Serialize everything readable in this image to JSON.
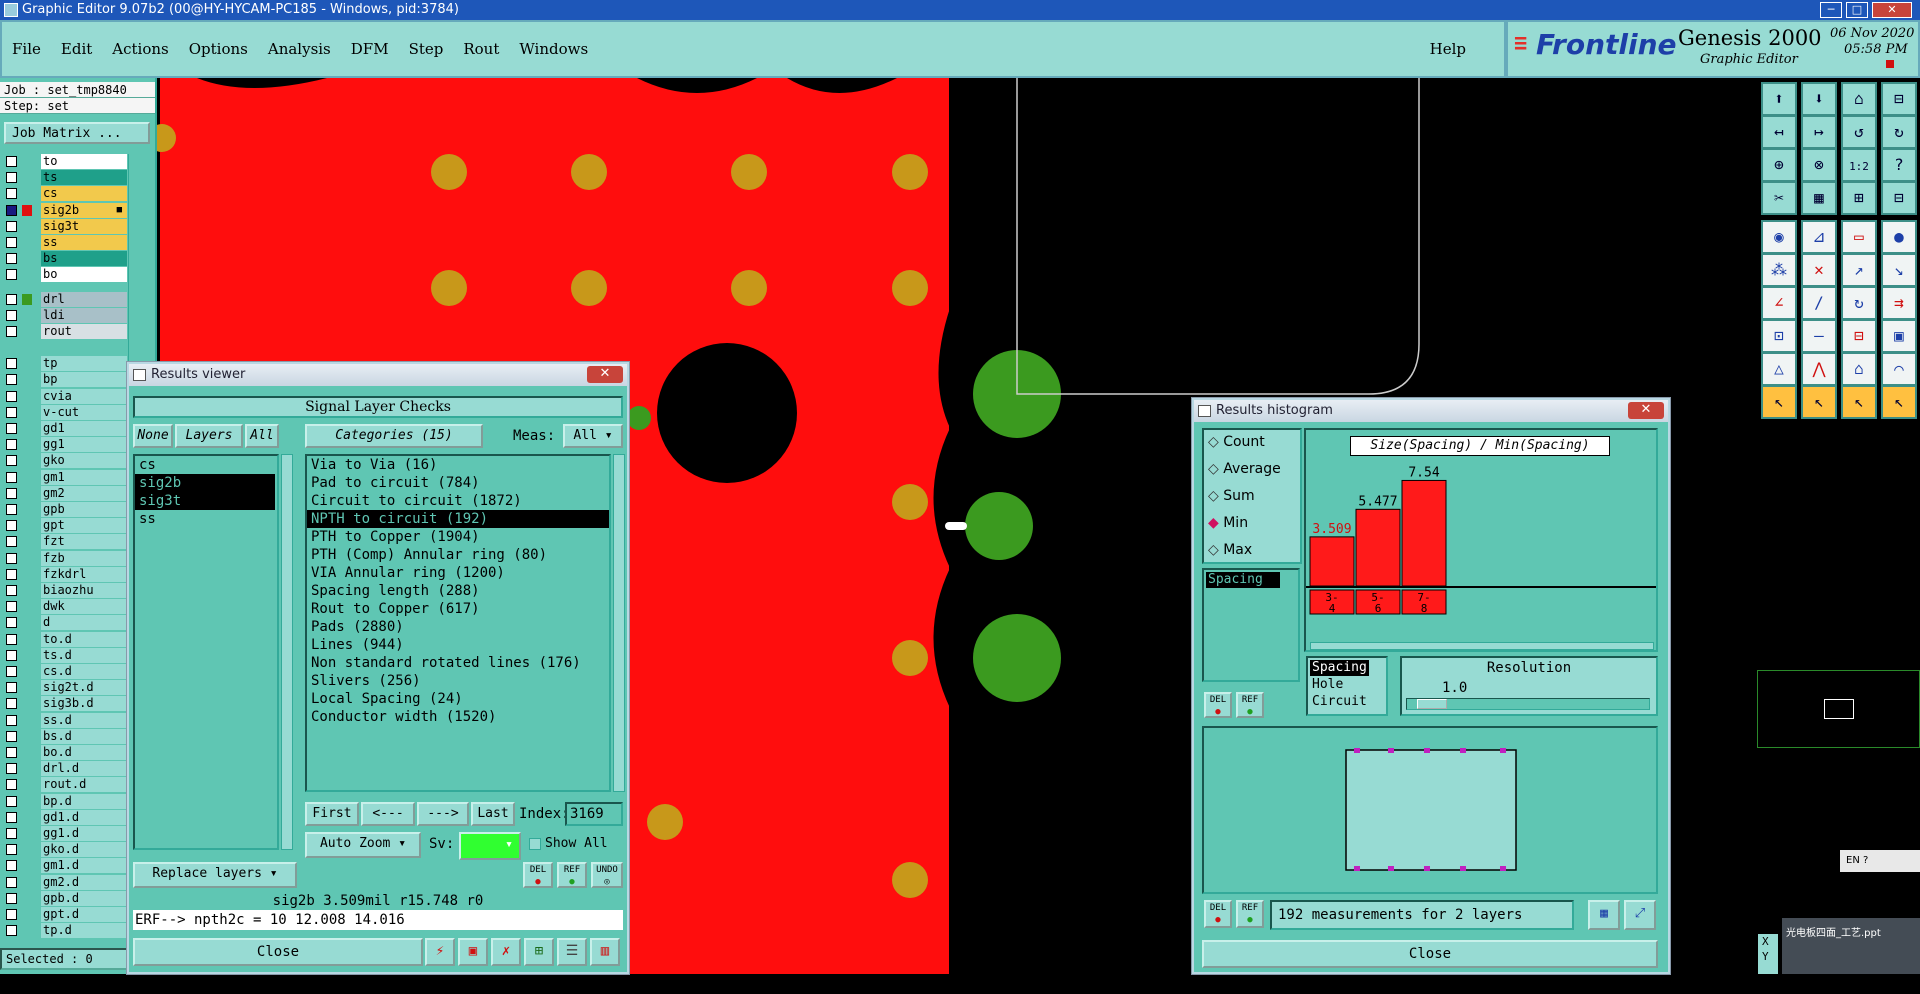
{
  "window": {
    "title": "Graphic Editor 9.07b2 (00@HY-HYCAM-PC185 - Windows, pid:3784)"
  },
  "menu": {
    "items": [
      "File",
      "Edit",
      "Actions",
      "Options",
      "Analysis",
      "DFM",
      "Step",
      "Rout",
      "Windows"
    ],
    "help": "Help"
  },
  "brand": {
    "vendor": "Frontline",
    "product": "Genesis 2000",
    "subtitle": "Graphic Editor",
    "date": "06 Nov 2020",
    "time": "05:58 PM"
  },
  "job": {
    "job_label": "Job : set_tmp8840",
    "step_label": "Step: set",
    "matrix_button": "Job Matrix ..."
  },
  "layers": [
    {
      "name": "to",
      "bg": "#ffffff",
      "sw": ""
    },
    {
      "name": "ts",
      "bg": "#1fa08a",
      "sw": ""
    },
    {
      "name": "cs",
      "bg": "#f2c94c",
      "sw": ""
    },
    {
      "name": "sig2b",
      "bg": "#f2c94c",
      "sw": "#e01010",
      "mark": "■",
      "sel": true
    },
    {
      "name": "sig3t",
      "bg": "#f2c94c",
      "sw": ""
    },
    {
      "name": "ss",
      "bg": "#f2c94c",
      "sw": ""
    },
    {
      "name": "bs",
      "bg": "#1fa08a",
      "sw": ""
    },
    {
      "name": "bo",
      "bg": "#ffffff",
      "sw": ""
    },
    {
      "name": "drl",
      "bg": "#a8c0c8",
      "sw": "#3b9a1f"
    },
    {
      "name": "ldi",
      "bg": "#a8c0c8",
      "sw": ""
    },
    {
      "name": "rout",
      "bg": "#d8e0e4",
      "sw": ""
    },
    {
      "name": "tp",
      "bg": "#97dbd3",
      "sw": ""
    },
    {
      "name": "bp",
      "bg": "#97dbd3",
      "sw": ""
    },
    {
      "name": "cvia",
      "bg": "#97dbd3",
      "sw": ""
    },
    {
      "name": "v-cut",
      "bg": "#97dbd3",
      "sw": ""
    },
    {
      "name": "gd1",
      "bg": "#97dbd3",
      "sw": ""
    },
    {
      "name": "gg1",
      "bg": "#97dbd3",
      "sw": ""
    },
    {
      "name": "gko",
      "bg": "#97dbd3",
      "sw": ""
    },
    {
      "name": "gm1",
      "bg": "#97dbd3",
      "sw": ""
    },
    {
      "name": "gm2",
      "bg": "#97dbd3",
      "sw": ""
    },
    {
      "name": "gpb",
      "bg": "#97dbd3",
      "sw": ""
    },
    {
      "name": "gpt",
      "bg": "#97dbd3",
      "sw": ""
    },
    {
      "name": "fzt",
      "bg": "#97dbd3",
      "sw": ""
    },
    {
      "name": "fzb",
      "bg": "#97dbd3",
      "sw": ""
    },
    {
      "name": "fzkdrl",
      "bg": "#97dbd3",
      "sw": ""
    },
    {
      "name": "biaozhu",
      "bg": "#97dbd3",
      "sw": ""
    },
    {
      "name": "dwk",
      "bg": "#97dbd3",
      "sw": ""
    },
    {
      "name": "d",
      "bg": "#97dbd3",
      "sw": ""
    },
    {
      "name": "to.d",
      "bg": "#97dbd3",
      "sw": ""
    },
    {
      "name": "ts.d",
      "bg": "#97dbd3",
      "sw": ""
    },
    {
      "name": "cs.d",
      "bg": "#97dbd3",
      "sw": ""
    },
    {
      "name": "sig2t.d",
      "bg": "#97dbd3",
      "sw": ""
    },
    {
      "name": "sig3b.d",
      "bg": "#97dbd3",
      "sw": ""
    },
    {
      "name": "ss.d",
      "bg": "#97dbd3",
      "sw": ""
    },
    {
      "name": "bs.d",
      "bg": "#97dbd3",
      "sw": ""
    },
    {
      "name": "bo.d",
      "bg": "#97dbd3",
      "sw": ""
    },
    {
      "name": "drl.d",
      "bg": "#97dbd3",
      "sw": ""
    },
    {
      "name": "rout.d",
      "bg": "#97dbd3",
      "sw": ""
    },
    {
      "name": "bp.d",
      "bg": "#97dbd3",
      "sw": ""
    },
    {
      "name": "gd1.d",
      "bg": "#97dbd3",
      "sw": ""
    },
    {
      "name": "gg1.d",
      "bg": "#97dbd3",
      "sw": ""
    },
    {
      "name": "gko.d",
      "bg": "#97dbd3",
      "sw": ""
    },
    {
      "name": "gm1.d",
      "bg": "#97dbd3",
      "sw": ""
    },
    {
      "name": "gm2.d",
      "bg": "#97dbd3",
      "sw": ""
    },
    {
      "name": "gpb.d",
      "bg": "#97dbd3",
      "sw": ""
    },
    {
      "name": "gpt.d",
      "bg": "#97dbd3",
      "sw": ""
    },
    {
      "name": "tp.d",
      "bg": "#97dbd3",
      "sw": ""
    }
  ],
  "status": {
    "selected": "Selected : 0"
  },
  "results_viewer": {
    "title": "Results viewer",
    "header": "Signal Layer Checks",
    "none_btn": "None",
    "layers_btn": "Layers",
    "all_btn": "All",
    "categories_btn": "Categories (15)",
    "meas_label": "Meas:",
    "meas_value": "All",
    "layer_list": [
      {
        "t": "cs",
        "sel": false
      },
      {
        "t": "sig2b",
        "sel": true
      },
      {
        "t": "sig3t",
        "sel": true
      },
      {
        "t": "ss",
        "sel": false
      }
    ],
    "categories": [
      {
        "t": "Via to Via (16)",
        "sel": false
      },
      {
        "t": "Pad to circuit (784)",
        "sel": false
      },
      {
        "t": "Circuit to circuit (1872)",
        "sel": false
      },
      {
        "t": "NPTH to circuit (192)",
        "sel": true
      },
      {
        "t": "PTH to Copper (1904)",
        "sel": false
      },
      {
        "t": "PTH (Comp) Annular ring (80)",
        "sel": false
      },
      {
        "t": "VIA Annular ring (1200)",
        "sel": false
      },
      {
        "t": "Spacing length (288)",
        "sel": false
      },
      {
        "t": "Rout to Copper (617)",
        "sel": false
      },
      {
        "t": "Pads (2880)",
        "sel": false
      },
      {
        "t": "Lines (944)",
        "sel": false
      },
      {
        "t": "Non standard rotated lines (176)",
        "sel": false
      },
      {
        "t": "Slivers (256)",
        "sel": false
      },
      {
        "t": "Local Spacing (24)",
        "sel": false
      },
      {
        "t": "Conductor width (1520)",
        "sel": false
      }
    ],
    "nav": {
      "first": "First",
      "prev": "<---",
      "next": "--->",
      "last": "Last",
      "index_label": "Index:",
      "index_value": "3169"
    },
    "auto_zoom": "Auto Zoom",
    "sv_label": "Sv:",
    "show_all": "Show All",
    "replace_layers": "Replace layers",
    "del": "DEL",
    "ref": "REF",
    "undo": "UNDO",
    "info_line": "sig2b 3.509mil  r15.748  r0",
    "erf_line": "ERF--> npth2c = 10 12.008 14.016",
    "close": "Close"
  },
  "histogram": {
    "title": "Results histogram",
    "options": [
      {
        "t": "Count",
        "on": false
      },
      {
        "t": "Average",
        "on": false
      },
      {
        "t": "Sum",
        "on": false
      },
      {
        "t": "Min",
        "on": true
      },
      {
        "t": "Max",
        "on": false
      }
    ],
    "chart_title": "Size(Spacing) / Min(Spacing)",
    "bars": [
      {
        "label": "3.509",
        "cat": "3-\n4",
        "v": 3.509,
        "hl": true
      },
      {
        "label": "5.477",
        "cat": "5-\n6",
        "v": 5.477,
        "hl": false
      },
      {
        "label": "7.54",
        "cat": "7-\n8",
        "v": 7.54,
        "hl": false
      }
    ],
    "cats": [
      "3-",
      "5-",
      "7-"
    ],
    "cats2": [
      "4",
      "6",
      "8"
    ],
    "measure_list": [
      "Spacing"
    ],
    "type_list": [
      {
        "t": "Spacing",
        "sel": true
      },
      {
        "t": "Hole",
        "sel": false
      },
      {
        "t": "Circuit",
        "sel": false
      }
    ],
    "resolution_label": "Resolution",
    "resolution_value": "1.0",
    "summary": "192 measurements for 2 layers",
    "del": "DEL",
    "ref": "REF",
    "close": "Close"
  },
  "taskbar_hint": "光电板四面_工艺.ppt",
  "ime": "EN",
  "xy_label": [
    "X",
    "Y"
  ]
}
